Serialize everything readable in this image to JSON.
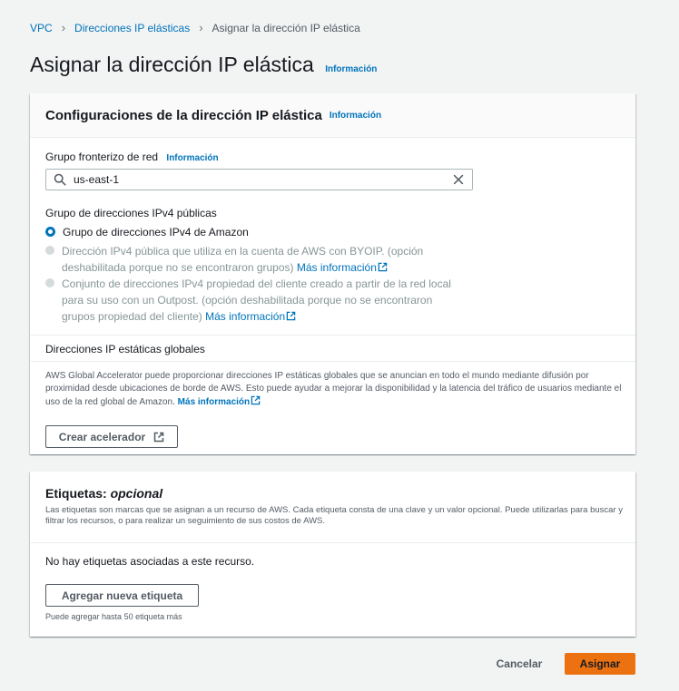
{
  "breadcrumb": {
    "items": [
      "VPC",
      "Direcciones IP elásticas",
      "Asignar la dirección IP elástica"
    ]
  },
  "page": {
    "title": "Asignar la dirección IP elástica",
    "info": "Información"
  },
  "settings": {
    "title": "Configuraciones de la dirección IP elástica",
    "info": "Información",
    "network_border_group": {
      "label": "Grupo fronterizo de red",
      "info": "Información",
      "value": "us-east-1"
    },
    "ipv4_pool": {
      "label": "Grupo de direcciones IPv4 públicas",
      "options": [
        {
          "label": "Grupo de direcciones IPv4 de Amazon",
          "selected": true,
          "disabled": false
        },
        {
          "label": "Dirección IPv4 pública que utiliza en la cuenta de AWS con BYOIP. (opción deshabilitada porque no se encontraron grupos)",
          "link": "Más información",
          "disabled": true
        },
        {
          "label": "Conjunto de direcciones IPv4 propiedad del cliente creado a partir de la red local para su uso con un Outpost. (opción deshabilitada porque no se encontraron grupos propiedad del cliente)",
          "link": "Más información",
          "disabled": true
        }
      ]
    },
    "global_static": {
      "label": "Direcciones IP estáticas globales",
      "description": "AWS Global Accelerator puede proporcionar direcciones IP estáticas globales que se anuncian en todo el mundo mediante difusión por proximidad desde ubicaciones de borde de AWS. Esto puede ayudar a mejorar la disponibilidad y la latencia del tráfico de usuarios mediante el uso de la red global de Amazon.",
      "link": "Más información",
      "button": "Crear acelerador"
    }
  },
  "tags": {
    "title_main": "Etiquetas:",
    "title_optional": "opcional",
    "description": "Las etiquetas son marcas que se asignan a un recurso de AWS. Cada etiqueta consta de una clave y un valor opcional. Puede utilizarlas para buscar y filtrar los recursos, o para realizar un seguimiento de sus costos de AWS.",
    "empty": "No hay etiquetas asociadas a este recurso.",
    "add_button": "Agregar nueva etiqueta",
    "limit_hint": "Puede agregar hasta 50 etiqueta más"
  },
  "footer": {
    "cancel": "Cancelar",
    "submit": "Asignar"
  },
  "colors": {
    "link": "#0073bb",
    "primary": "#ec7211",
    "background": "#f2f3f3"
  }
}
